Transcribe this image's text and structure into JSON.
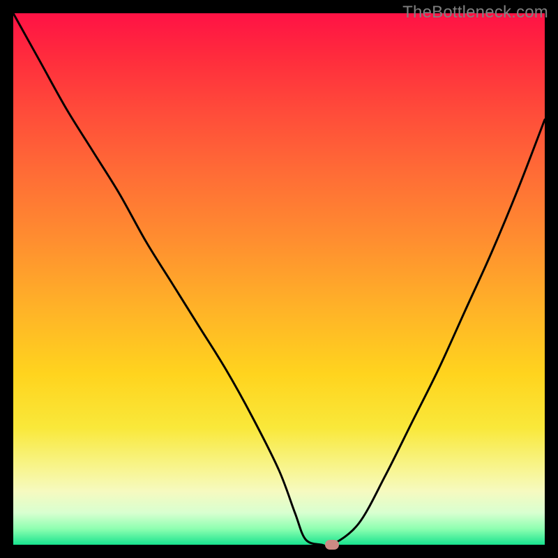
{
  "watermark": "TheBottleneck.com",
  "chart_data": {
    "type": "line",
    "title": "",
    "xlabel": "",
    "ylabel": "",
    "xlim": [
      0,
      100
    ],
    "ylim": [
      0,
      100
    ],
    "grid": false,
    "legend": false,
    "series": [
      {
        "name": "bottleneck-curve",
        "color": "#000000",
        "x": [
          0,
          5,
          10,
          15,
          20,
          25,
          30,
          35,
          40,
          45,
          50,
          53,
          55,
          58,
          60,
          65,
          70,
          75,
          80,
          85,
          90,
          95,
          100
        ],
        "y": [
          100,
          91,
          82,
          74,
          66,
          57,
          49,
          41,
          33,
          24,
          14,
          6,
          1,
          0,
          0,
          4,
          13,
          23,
          33,
          44,
          55,
          67,
          80
        ]
      }
    ],
    "marker": {
      "x": 60,
      "y": 0,
      "color": "#cc8a84"
    }
  },
  "colors": {
    "frame": "#000000",
    "watermark": "#808080",
    "curve": "#000000",
    "marker": "#cc8a84"
  }
}
